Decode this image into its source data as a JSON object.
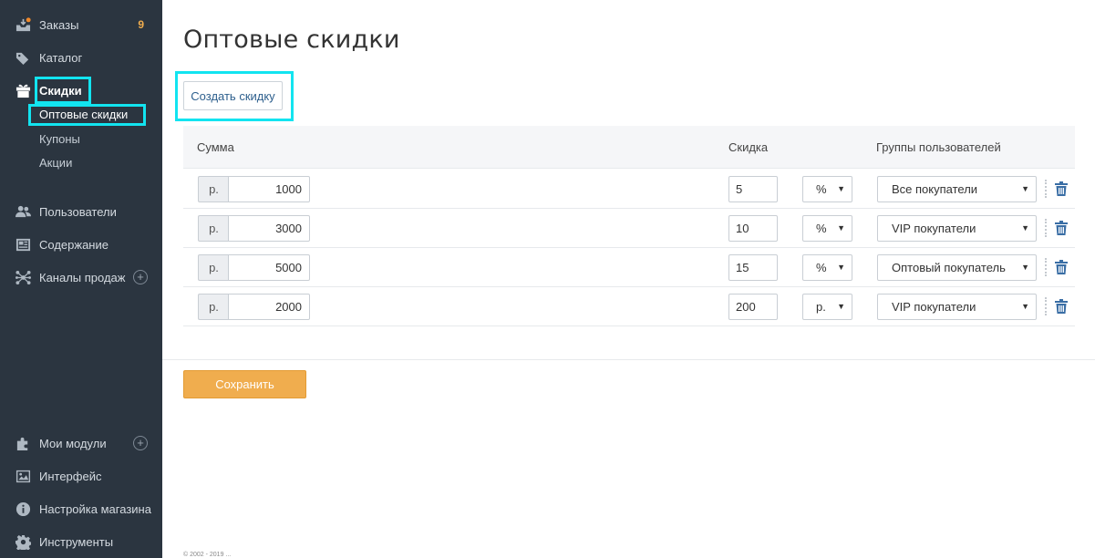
{
  "sidebar": {
    "orders": {
      "label": "Заказы",
      "count": "9"
    },
    "catalog": {
      "label": "Каталог"
    },
    "discounts": {
      "label": "Скидки"
    },
    "sub": [
      {
        "label": "Оптовые скидки"
      },
      {
        "label": "Купоны"
      },
      {
        "label": "Акции"
      }
    ],
    "users": {
      "label": "Пользователи"
    },
    "content": {
      "label": "Содержание"
    },
    "channels": {
      "label": "Каналы продаж",
      "plus": "+"
    },
    "modules": {
      "label": "Мои модули",
      "plus": "+"
    },
    "interface": {
      "label": "Интерфейс"
    },
    "settings": {
      "label": "Настройка магазина"
    },
    "tools": {
      "label": "Инструменты"
    }
  },
  "main": {
    "title": "Оптовые скидки",
    "create_button": "Создать скидку",
    "headers": {
      "sum": "Сумма",
      "discount": "Скидка",
      "groups": "Группы пользователей"
    },
    "rows": [
      {
        "prefix": "р.",
        "sum": "1000",
        "discount": "5",
        "unit": "%",
        "group": "Все покупатели"
      },
      {
        "prefix": "р.",
        "sum": "3000",
        "discount": "10",
        "unit": "%",
        "group": "VIP покупатели"
      },
      {
        "prefix": "р.",
        "sum": "5000",
        "discount": "15",
        "unit": "%",
        "group": "Оптовый покупатель"
      },
      {
        "prefix": "р.",
        "sum": "2000",
        "discount": "200",
        "unit": "р.",
        "group": "VIP покупатели"
      }
    ],
    "save_button": "Сохранить",
    "footer": "© 2002 - 2019 ..."
  },
  "colors": {
    "sidebar_bg": "#2b3540",
    "accent": "#f0ad4e",
    "highlight": "#12e4f0",
    "order_badge": "#f0ad4e"
  }
}
